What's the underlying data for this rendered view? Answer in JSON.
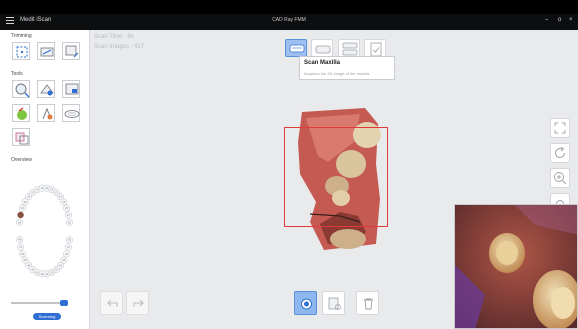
{
  "app": {
    "breadcrumb": "Medit iScan",
    "window_title": "CAD Ray FMM",
    "window_controls": {
      "minimize": "–",
      "restore": "o",
      "close": "×"
    }
  },
  "left_panel": {
    "trimming_title": "Trimming",
    "tools_title": "Tools",
    "overview_title": "Overview",
    "tooth_numbers_upper": [
      "18",
      "17",
      "16",
      "15",
      "14",
      "13",
      "12",
      "11",
      "21",
      "22",
      "23",
      "24",
      "25",
      "26",
      "27",
      "28"
    ],
    "tooth_numbers_lower": [
      "48",
      "47",
      "46",
      "45",
      "44",
      "43",
      "42",
      "41",
      "31",
      "32",
      "33",
      "34",
      "35",
      "36",
      "37",
      "38"
    ],
    "scan_mode_label": "Scanning"
  },
  "scan_stats": {
    "time_label": "Scan Time : 8s",
    "images_label": "Scan Images : 417"
  },
  "stage_toolbar": {
    "active": "scan-maxilla",
    "items": [
      "scan-maxilla",
      "scan-mandible",
      "scan-occlusion",
      "scan-verify"
    ]
  },
  "tooltip": {
    "title": "Scan Maxilla",
    "description": "Acquires the 3D image of the maxilla."
  },
  "colors": {
    "accent": "#2f6fd3",
    "roi_box": "#e03a3a",
    "top_bar": "#0d0e10"
  }
}
